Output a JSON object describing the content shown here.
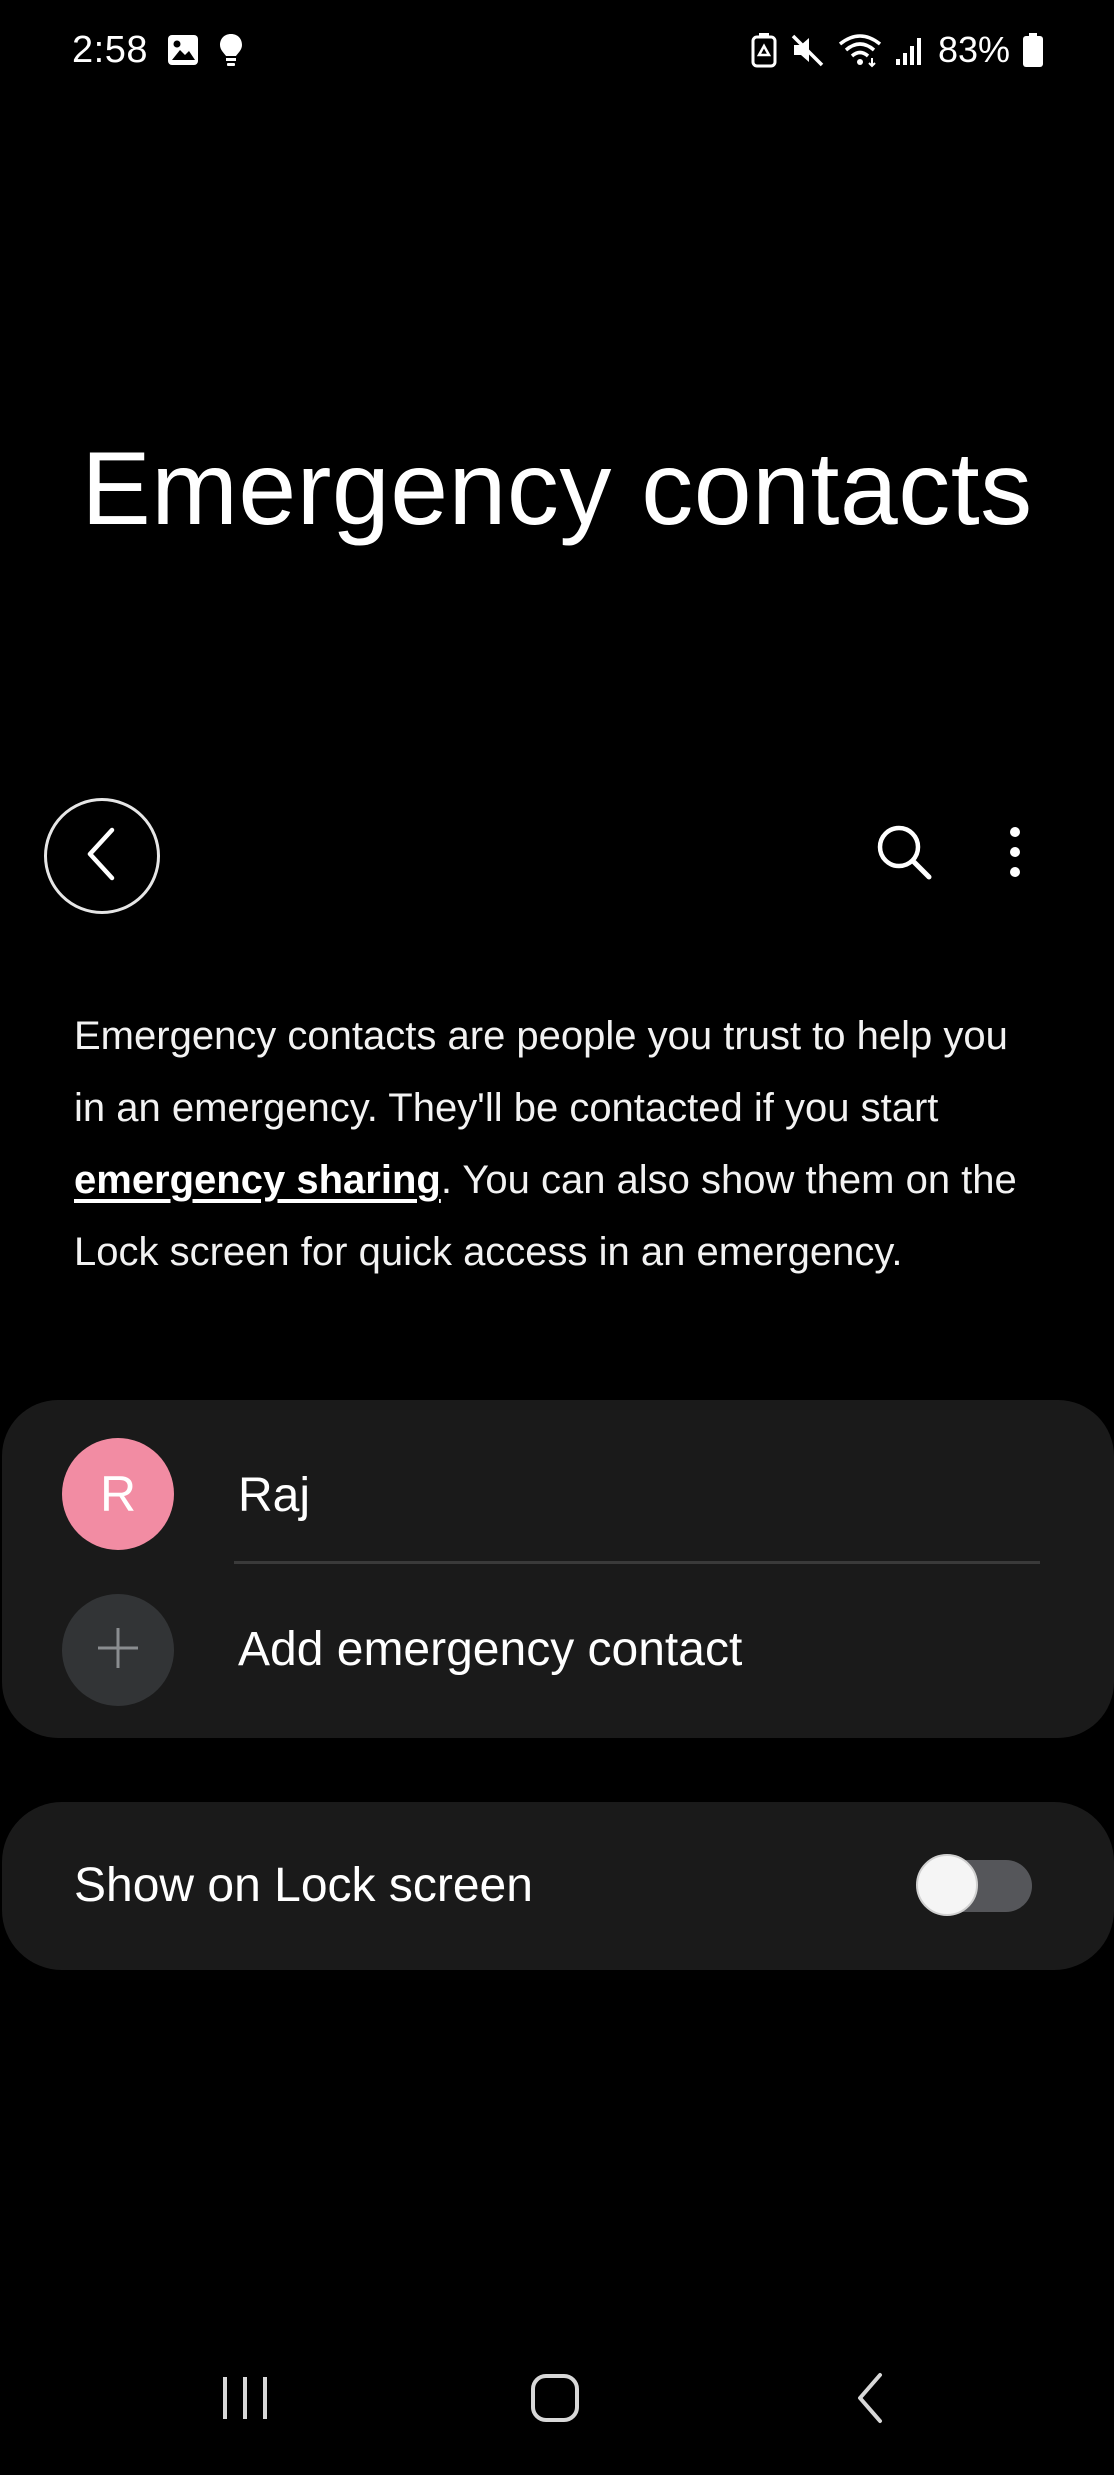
{
  "status_bar": {
    "time": "2:58",
    "battery_percent": "83%",
    "left_icons": [
      "gallery-icon",
      "lightbulb-icon"
    ],
    "right_icons": [
      "battery-saver-icon",
      "mute-icon",
      "wifi-icon",
      "signal-icon",
      "battery-icon"
    ]
  },
  "page": {
    "title": "Emergency contacts"
  },
  "toolbar": {
    "icons": [
      "back-icon",
      "search-icon",
      "more-options-icon"
    ]
  },
  "description": {
    "part1": "Emergency contacts are people you trust to help you in an emergency. They'll be contacted if you start ",
    "link": "emergency sharing",
    "part2": ". You can also show them on the Lock screen for quick access in an emergency."
  },
  "contacts": {
    "items": [
      {
        "initial": "R",
        "name": "Raj",
        "avatar_color": "#f28ca3"
      }
    ],
    "add_label": "Add emergency contact"
  },
  "lock_screen": {
    "label": "Show on Lock screen",
    "enabled": false
  },
  "nav_bar": {
    "icons": [
      "recents-icon",
      "home-icon",
      "back-nav-icon"
    ]
  },
  "colors": {
    "background": "#000000",
    "card": "#1a1a1a",
    "text": "#ffffff",
    "toggle_off_track": "#55565a"
  }
}
